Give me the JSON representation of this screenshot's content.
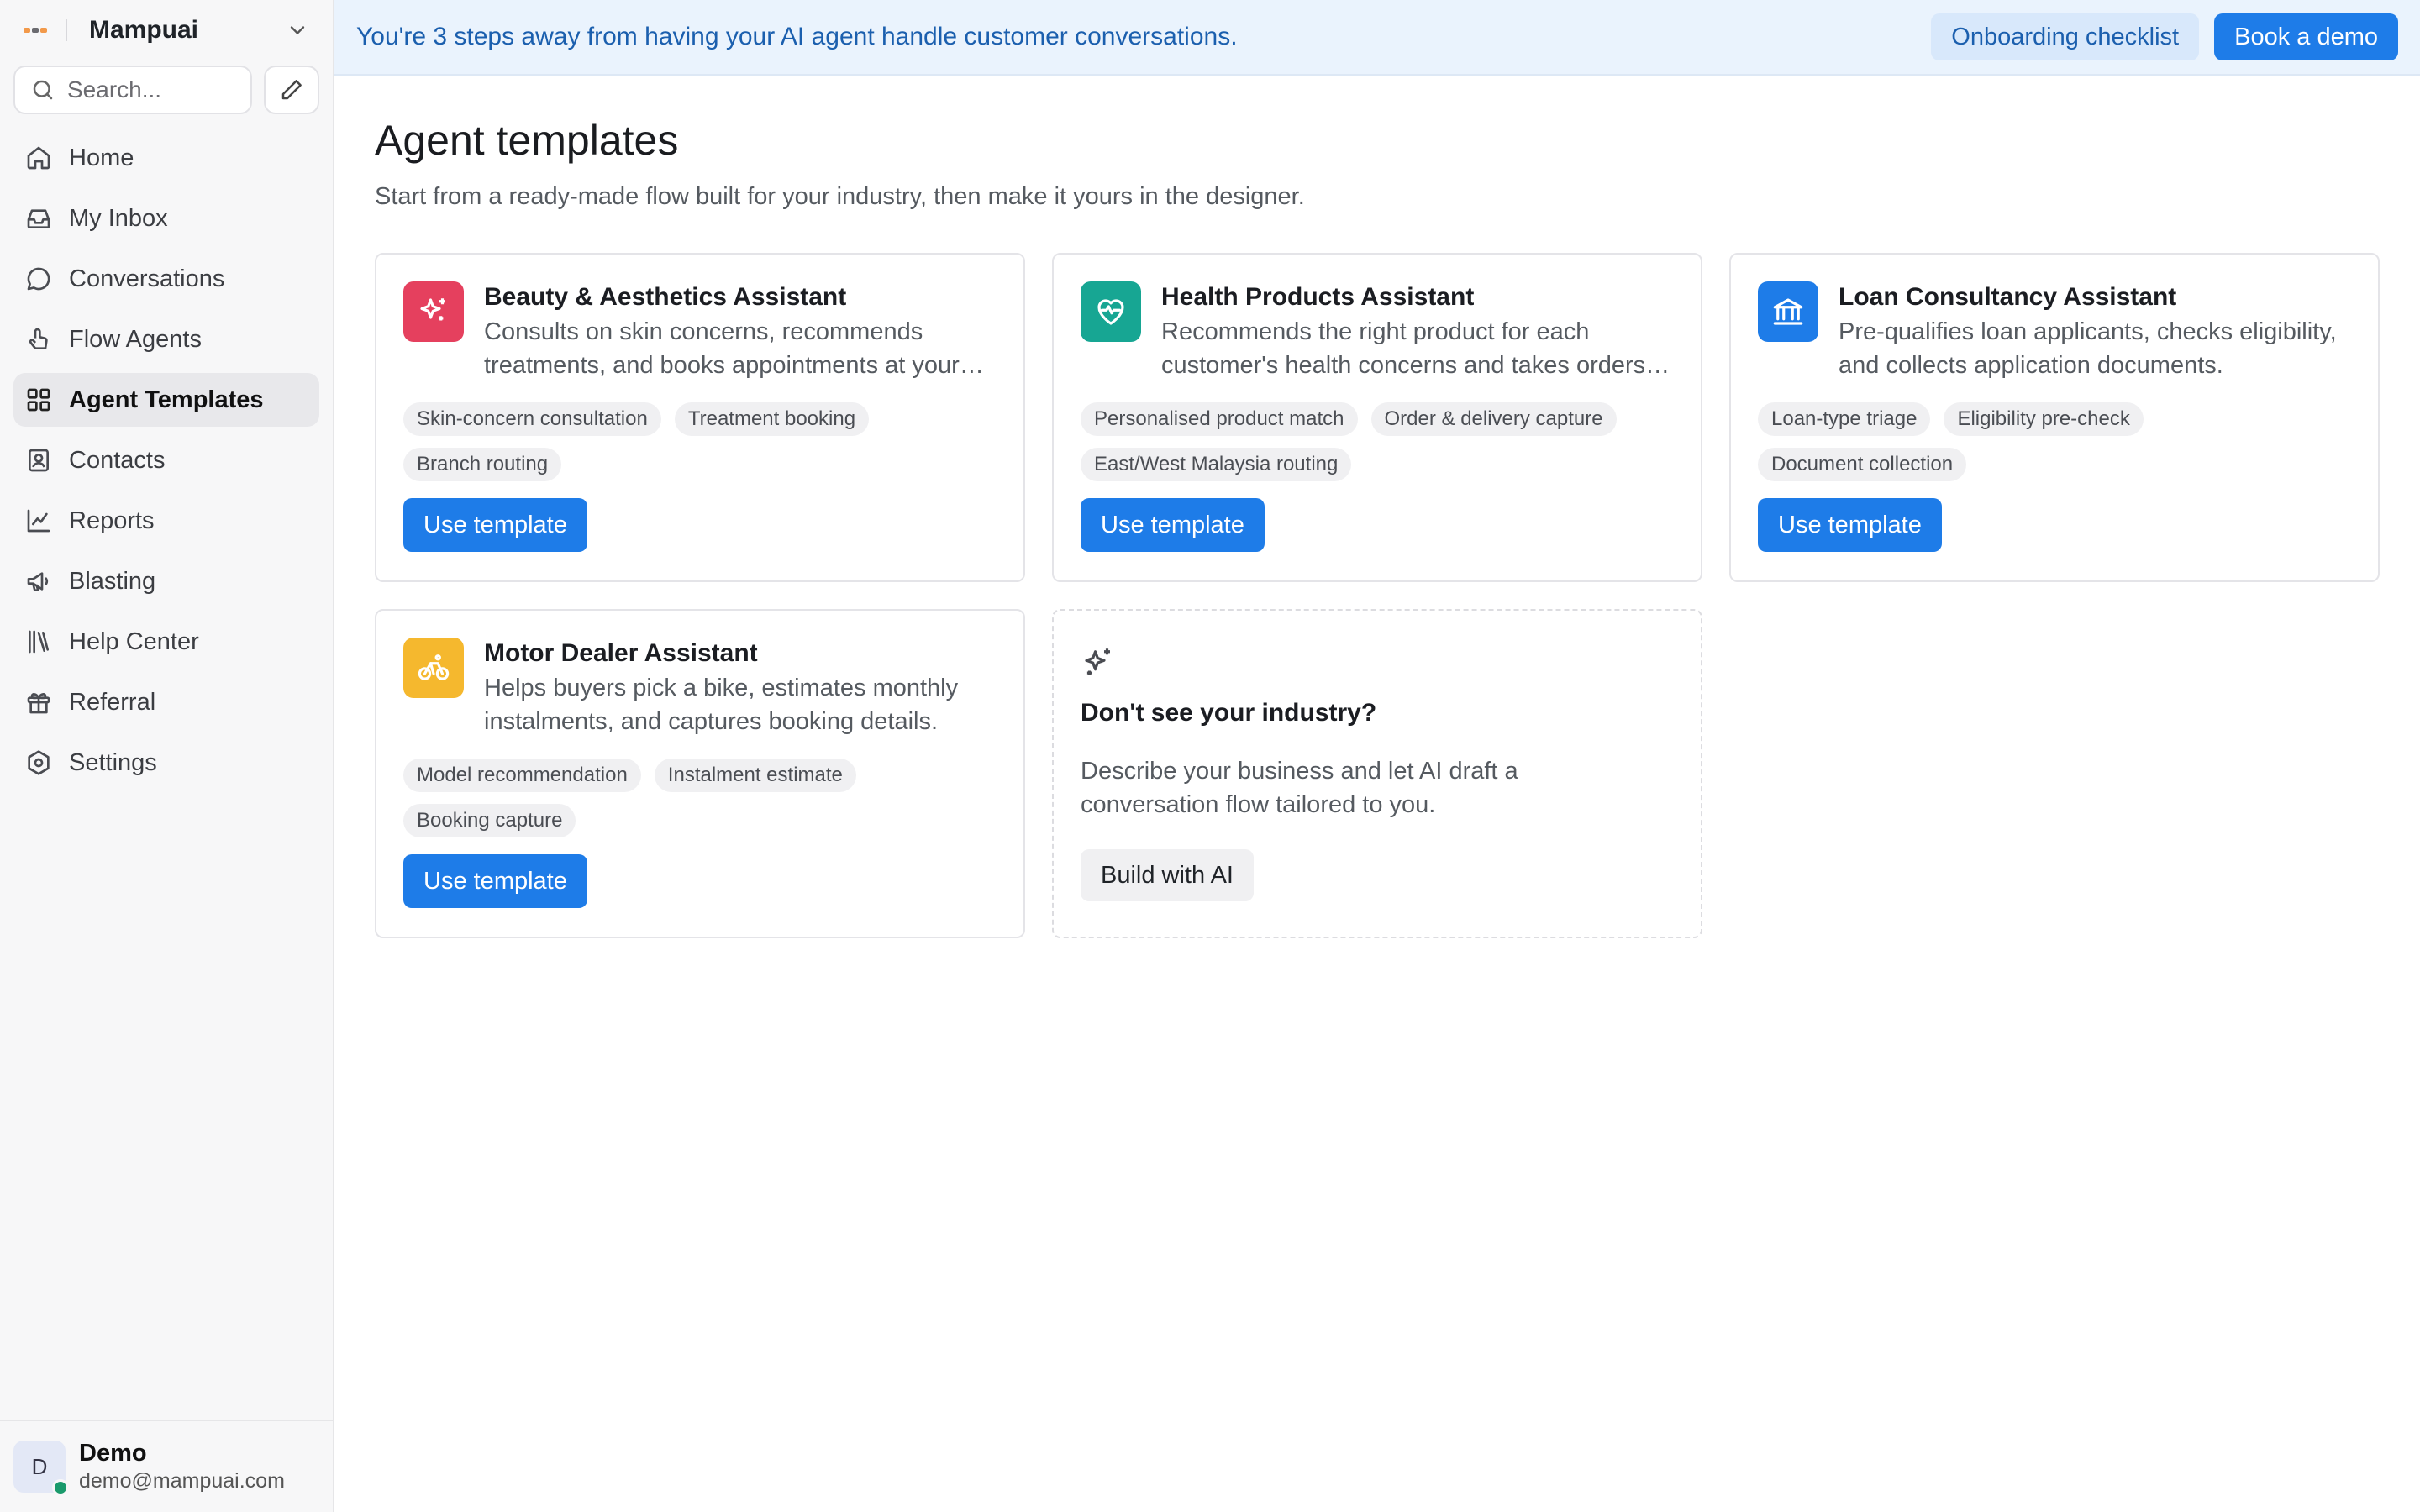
{
  "workspace": {
    "name": "Mampuai",
    "logo_colors": [
      "#f2994a",
      "#6b6b70",
      "#f2994a"
    ]
  },
  "search": {
    "placeholder": "Search..."
  },
  "nav": {
    "items": [
      {
        "label": "Home",
        "icon": "home-icon"
      },
      {
        "label": "My Inbox",
        "icon": "inbox-icon"
      },
      {
        "label": "Conversations",
        "icon": "chat-bubble-icon"
      },
      {
        "label": "Flow Agents",
        "icon": "pointer-icon"
      },
      {
        "label": "Agent Templates",
        "icon": "grid-icon",
        "active": true
      },
      {
        "label": "Contacts",
        "icon": "contact-card-icon"
      },
      {
        "label": "Reports",
        "icon": "line-chart-icon"
      },
      {
        "label": "Blasting",
        "icon": "megaphone-icon"
      },
      {
        "label": "Help Center",
        "icon": "library-icon"
      },
      {
        "label": "Referral",
        "icon": "gift-icon"
      },
      {
        "label": "Settings",
        "icon": "settings-icon"
      }
    ]
  },
  "user": {
    "initial": "D",
    "name": "Demo",
    "email": "demo@mampuai.com"
  },
  "banner": {
    "text": "You're 3 steps away from having your AI agent handle customer conversations.",
    "checklist_label": "Onboarding checklist",
    "demo_label": "Book a demo"
  },
  "page": {
    "title": "Agent templates",
    "subtitle": "Start from a ready-made flow built for your industry, then make it yours in the designer."
  },
  "templates": [
    {
      "title": "Beauty & Aesthetics Assistant",
      "description": "Consults on skin concerns, recommends treatments, and books appointments at your nearest branch.",
      "tags": [
        "Skin-concern consultation",
        "Treatment booking",
        "Branch routing"
      ],
      "icon": "sparkles-icon",
      "color": "#e5405e",
      "button": "Use template"
    },
    {
      "title": "Health Products Assistant",
      "description": "Recommends the right product for each customer's health concerns and takes orders for delivery.",
      "tags": [
        "Personalised product match",
        "Order & delivery capture",
        "East/West Malaysia routing"
      ],
      "icon": "heart-pulse-icon",
      "color": "#17a693",
      "button": "Use template"
    },
    {
      "title": "Loan Consultancy Assistant",
      "description": "Pre-qualifies loan applicants, checks eligibility, and collects application documents.",
      "tags": [
        "Loan-type triage",
        "Eligibility pre-check",
        "Document collection"
      ],
      "icon": "bank-icon",
      "color": "#1e7ce8",
      "button": "Use template"
    },
    {
      "title": "Motor Dealer Assistant",
      "description": "Helps buyers pick a bike, estimates monthly instalments, and captures booking details.",
      "tags": [
        "Model recommendation",
        "Instalment estimate",
        "Booking capture"
      ],
      "icon": "bicycle-icon",
      "color": "#f5b82e",
      "button": "Use template"
    }
  ],
  "ai_card": {
    "title": "Don't see your industry?",
    "description": "Describe your business and let AI draft a conversation flow tailored to you.",
    "button": "Build with AI",
    "icon": "sparkles-icon"
  }
}
